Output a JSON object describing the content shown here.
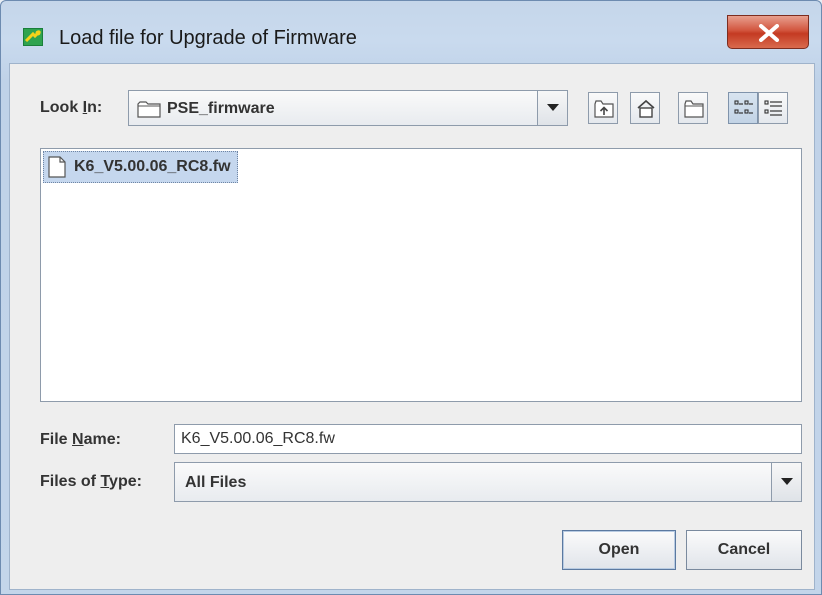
{
  "window": {
    "title": "Load file for Upgrade of Firmware",
    "close_icon": "close-x-icon",
    "app_icon": "firmware-app-icon"
  },
  "look_in": {
    "label_pre": "Look ",
    "label_mnemonic": "I",
    "label_post": "n:",
    "value": "PSE_firmware",
    "icon": "folder-icon"
  },
  "toolbar": {
    "icons": [
      "up-one-level-icon",
      "home-icon",
      "new-folder-icon",
      "list-view-icon",
      "details-view-icon"
    ],
    "active_view": "list-view"
  },
  "files": [
    {
      "name": "K6_V5.00.06_RC8.fw",
      "icon": "file-icon",
      "selected": true
    }
  ],
  "file_name": {
    "label_pre": "File ",
    "label_mnemonic": "N",
    "label_post": "ame:",
    "value": "K6_V5.00.06_RC8.fw"
  },
  "file_type": {
    "label_pre": "Files of ",
    "label_mnemonic": "T",
    "label_post": "ype:",
    "value": "All Files"
  },
  "buttons": {
    "open": "Open",
    "cancel": "Cancel"
  }
}
